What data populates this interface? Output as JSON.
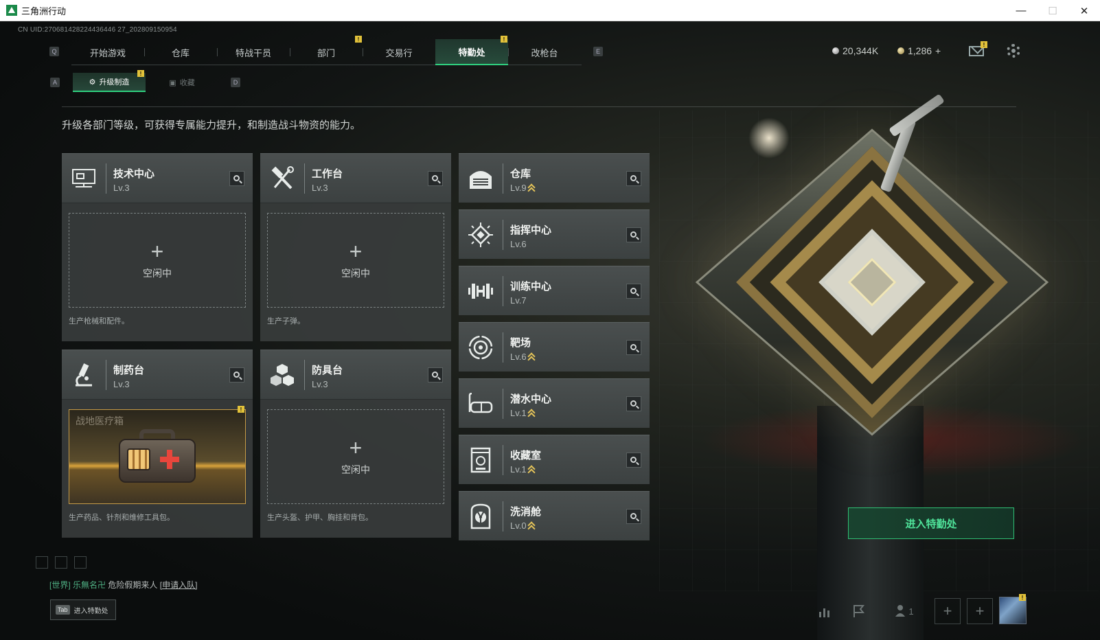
{
  "window": {
    "title": "三角洲行动",
    "minimize": "—",
    "maximize": "☐",
    "close": "✕"
  },
  "uid": "CN UID:270681428224436446 27_202809150954",
  "keys": {
    "prev_tab": "Q",
    "next_tab": "E",
    "prev_sub": "A",
    "next_sub": "D"
  },
  "nav": {
    "tabs": [
      "开始游戏",
      "仓库",
      "特战干员",
      "部门",
      "交易行",
      "特勤处",
      "改枪台"
    ],
    "active": "特勤处",
    "badge": "!"
  },
  "currency": {
    "silver": "20,344K",
    "gold": "1,286",
    "gold_add": "+"
  },
  "subtabs": {
    "active_label": "升级制造",
    "other_label": "收藏"
  },
  "intro": "升级各部门等级，可获得专属能力提升，和制造战斗物资的能力。",
  "workshops": [
    {
      "name": "技术中心",
      "level": "Lv.3",
      "slot": "空闲中",
      "desc": "生产枪械和配件。",
      "icon": "computer-icon"
    },
    {
      "name": "工作台",
      "level": "Lv.3",
      "slot": "空闲中",
      "desc": "生产子弹。",
      "icon": "hammer-wrench-icon"
    },
    {
      "name": "制药台",
      "level": "Lv.3",
      "slot_item": "战地医疗箱",
      "desc": "生产药品、针剂和维修工具包。",
      "icon": "microscope-icon"
    },
    {
      "name": "防具台",
      "level": "Lv.3",
      "slot": "空闲中",
      "desc": "生产头盔、护甲、胸挂和背包。",
      "icon": "cubes-icon"
    }
  ],
  "departments": [
    {
      "name": "仓库",
      "level": "Lv.9",
      "upgrade": true,
      "icon": "warehouse-icon"
    },
    {
      "name": "指挥中心",
      "level": "Lv.6",
      "upgrade": false,
      "icon": "chip-icon"
    },
    {
      "name": "训练中心",
      "level": "Lv.7",
      "upgrade": false,
      "icon": "dumbbell-icon"
    },
    {
      "name": "靶场",
      "level": "Lv.6",
      "upgrade": true,
      "icon": "target-icon"
    },
    {
      "name": "潜水中心",
      "level": "Lv.1",
      "upgrade": true,
      "icon": "diving-mask-icon"
    },
    {
      "name": "收藏室",
      "level": "Lv.1",
      "upgrade": true,
      "icon": "collection-icon"
    },
    {
      "name": "洗消舱",
      "level": "Lv.0",
      "upgrade": true,
      "icon": "radiation-icon"
    }
  ],
  "enter_button": "进入特勤处",
  "chat": {
    "channel": "[世界]",
    "sender": "乐無名卍",
    "message": "危险假期来人",
    "link": "[申请入队]"
  },
  "tab_hint": {
    "key": "Tab",
    "label": "进入特勤处"
  },
  "bottom": {
    "party_count": "1"
  },
  "colors": {
    "accent": "#2fd07f",
    "badge": "#e2c23a",
    "upgrade": "#e3c359"
  }
}
